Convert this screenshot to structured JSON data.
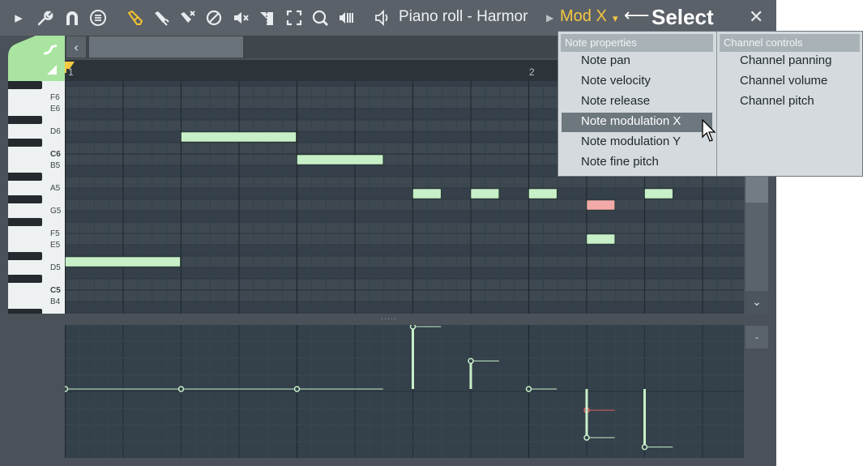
{
  "titlebar": {
    "title": "Piano roll - Harmor",
    "mod_label": "Mod X",
    "select_label": "Select",
    "icons": [
      "play-arrow-icon",
      "wrench-icon",
      "magnet-icon",
      "menu-icon",
      "pencil-icon",
      "paint-brush-icon",
      "delete-brush-icon",
      "mute-icon",
      "speaker-mute-icon",
      "slice-icon",
      "select-icon",
      "zoom-icon",
      "playback-icon",
      "speaker-icon",
      "close-icon"
    ]
  },
  "ruler": {
    "bar1": "1",
    "bar2": "2"
  },
  "keyboard": {
    "labels": [
      "F6",
      "E6",
      "D6",
      "C6",
      "B5",
      "A5",
      "G5",
      "F5",
      "E5",
      "D5",
      "C5",
      "B4"
    ]
  },
  "notes": [
    {
      "pitch": "D5",
      "start_step": 0,
      "length_steps": 8,
      "color": "#c8f0c8"
    },
    {
      "pitch": "C#6",
      "start_step": 8,
      "length_steps": 8,
      "color": "#c8f0c8"
    },
    {
      "pitch": "B5",
      "start_step": 16,
      "length_steps": 6,
      "color": "#c8f0c8"
    },
    {
      "pitch": "G#5",
      "start_step": 24,
      "length_steps": 2,
      "color": "#c8f0c8"
    },
    {
      "pitch": "G#5",
      "start_step": 28,
      "length_steps": 2,
      "color": "#c8f0c8"
    },
    {
      "pitch": "G#5",
      "start_step": 32,
      "length_steps": 2,
      "color": "#c8f0c8"
    },
    {
      "pitch": "G5",
      "start_step": 36,
      "length_steps": 2,
      "color": "#f4a9a9"
    },
    {
      "pitch": "E5",
      "start_step": 36,
      "length_steps": 2,
      "color": "#c8f0c8"
    },
    {
      "pitch": "G#5",
      "start_step": 40,
      "length_steps": 2,
      "color": "#c8f0c8"
    }
  ],
  "menu": {
    "col1_header": "Note properties",
    "col1_items": [
      "Note pan",
      "Note velocity",
      "Note release",
      "Note modulation X",
      "Note modulation Y",
      "Note fine pitch"
    ],
    "selected_item": "Note modulation X",
    "col2_header": "Channel controls",
    "col2_items": [
      "Channel panning",
      "Channel volume",
      "Channel pitch"
    ]
  },
  "event_button_label": "-",
  "colors": {
    "accent": "#f5c842",
    "note": "#c8f0c8",
    "selected_note": "#f4a9a9",
    "window_bg": "#4a5158"
  }
}
